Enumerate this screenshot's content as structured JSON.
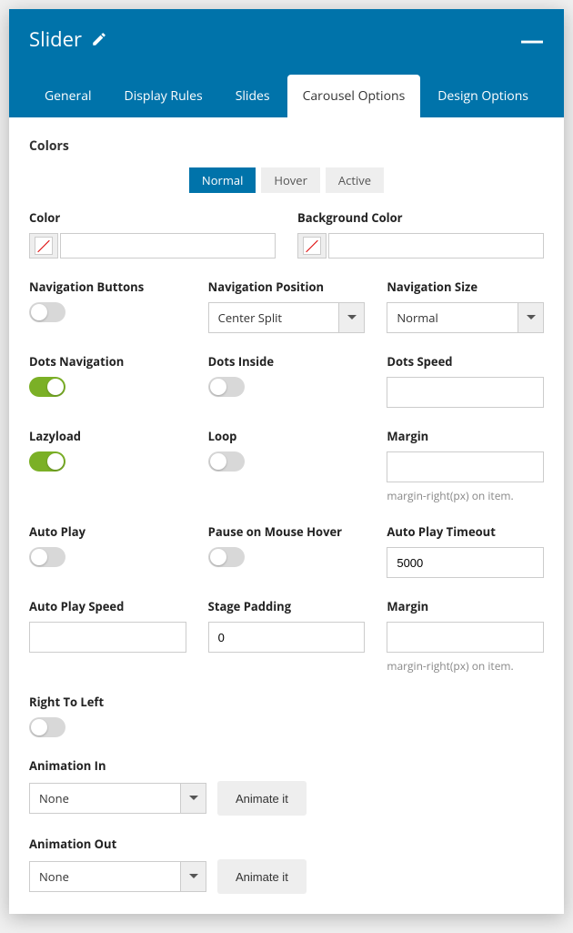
{
  "header": {
    "title": "Slider"
  },
  "tabs": {
    "general": "General",
    "display_rules": "Display Rules",
    "slides": "Slides",
    "carousel_options": "Carousel Options",
    "design_options": "Design Options"
  },
  "colors": {
    "section_label": "Colors",
    "states": {
      "normal": "Normal",
      "hover": "Hover",
      "active": "Active"
    },
    "color_label": "Color",
    "bg_label": "Background Color"
  },
  "fields": {
    "nav_buttons": {
      "label": "Navigation Buttons",
      "value": false
    },
    "nav_position": {
      "label": "Navigation Position",
      "value": "Center Split"
    },
    "nav_size": {
      "label": "Navigation Size",
      "value": "Normal"
    },
    "dots_nav": {
      "label": "Dots Navigation",
      "value": true
    },
    "dots_inside": {
      "label": "Dots Inside",
      "value": false
    },
    "dots_speed": {
      "label": "Dots Speed",
      "value": ""
    },
    "lazyload": {
      "label": "Lazyload",
      "value": true
    },
    "loop": {
      "label": "Loop",
      "value": false
    },
    "margin1": {
      "label": "Margin",
      "value": "",
      "help": "margin-right(px) on item."
    },
    "autoplay": {
      "label": "Auto Play",
      "value": false
    },
    "pause_hover": {
      "label": "Pause on Mouse Hover",
      "value": false
    },
    "autoplay_timeout": {
      "label": "Auto Play Timeout",
      "value": "5000"
    },
    "autoplay_speed": {
      "label": "Auto Play Speed",
      "value": ""
    },
    "stage_padding": {
      "label": "Stage Padding",
      "value": "0"
    },
    "margin2": {
      "label": "Margin",
      "value": "",
      "help": "margin-right(px) on item."
    },
    "rtl": {
      "label": "Right To Left",
      "value": false
    },
    "animation_in": {
      "label": "Animation In",
      "value": "None",
      "button": "Animate it"
    },
    "animation_out": {
      "label": "Animation Out",
      "value": "None",
      "button": "Animate it"
    }
  }
}
